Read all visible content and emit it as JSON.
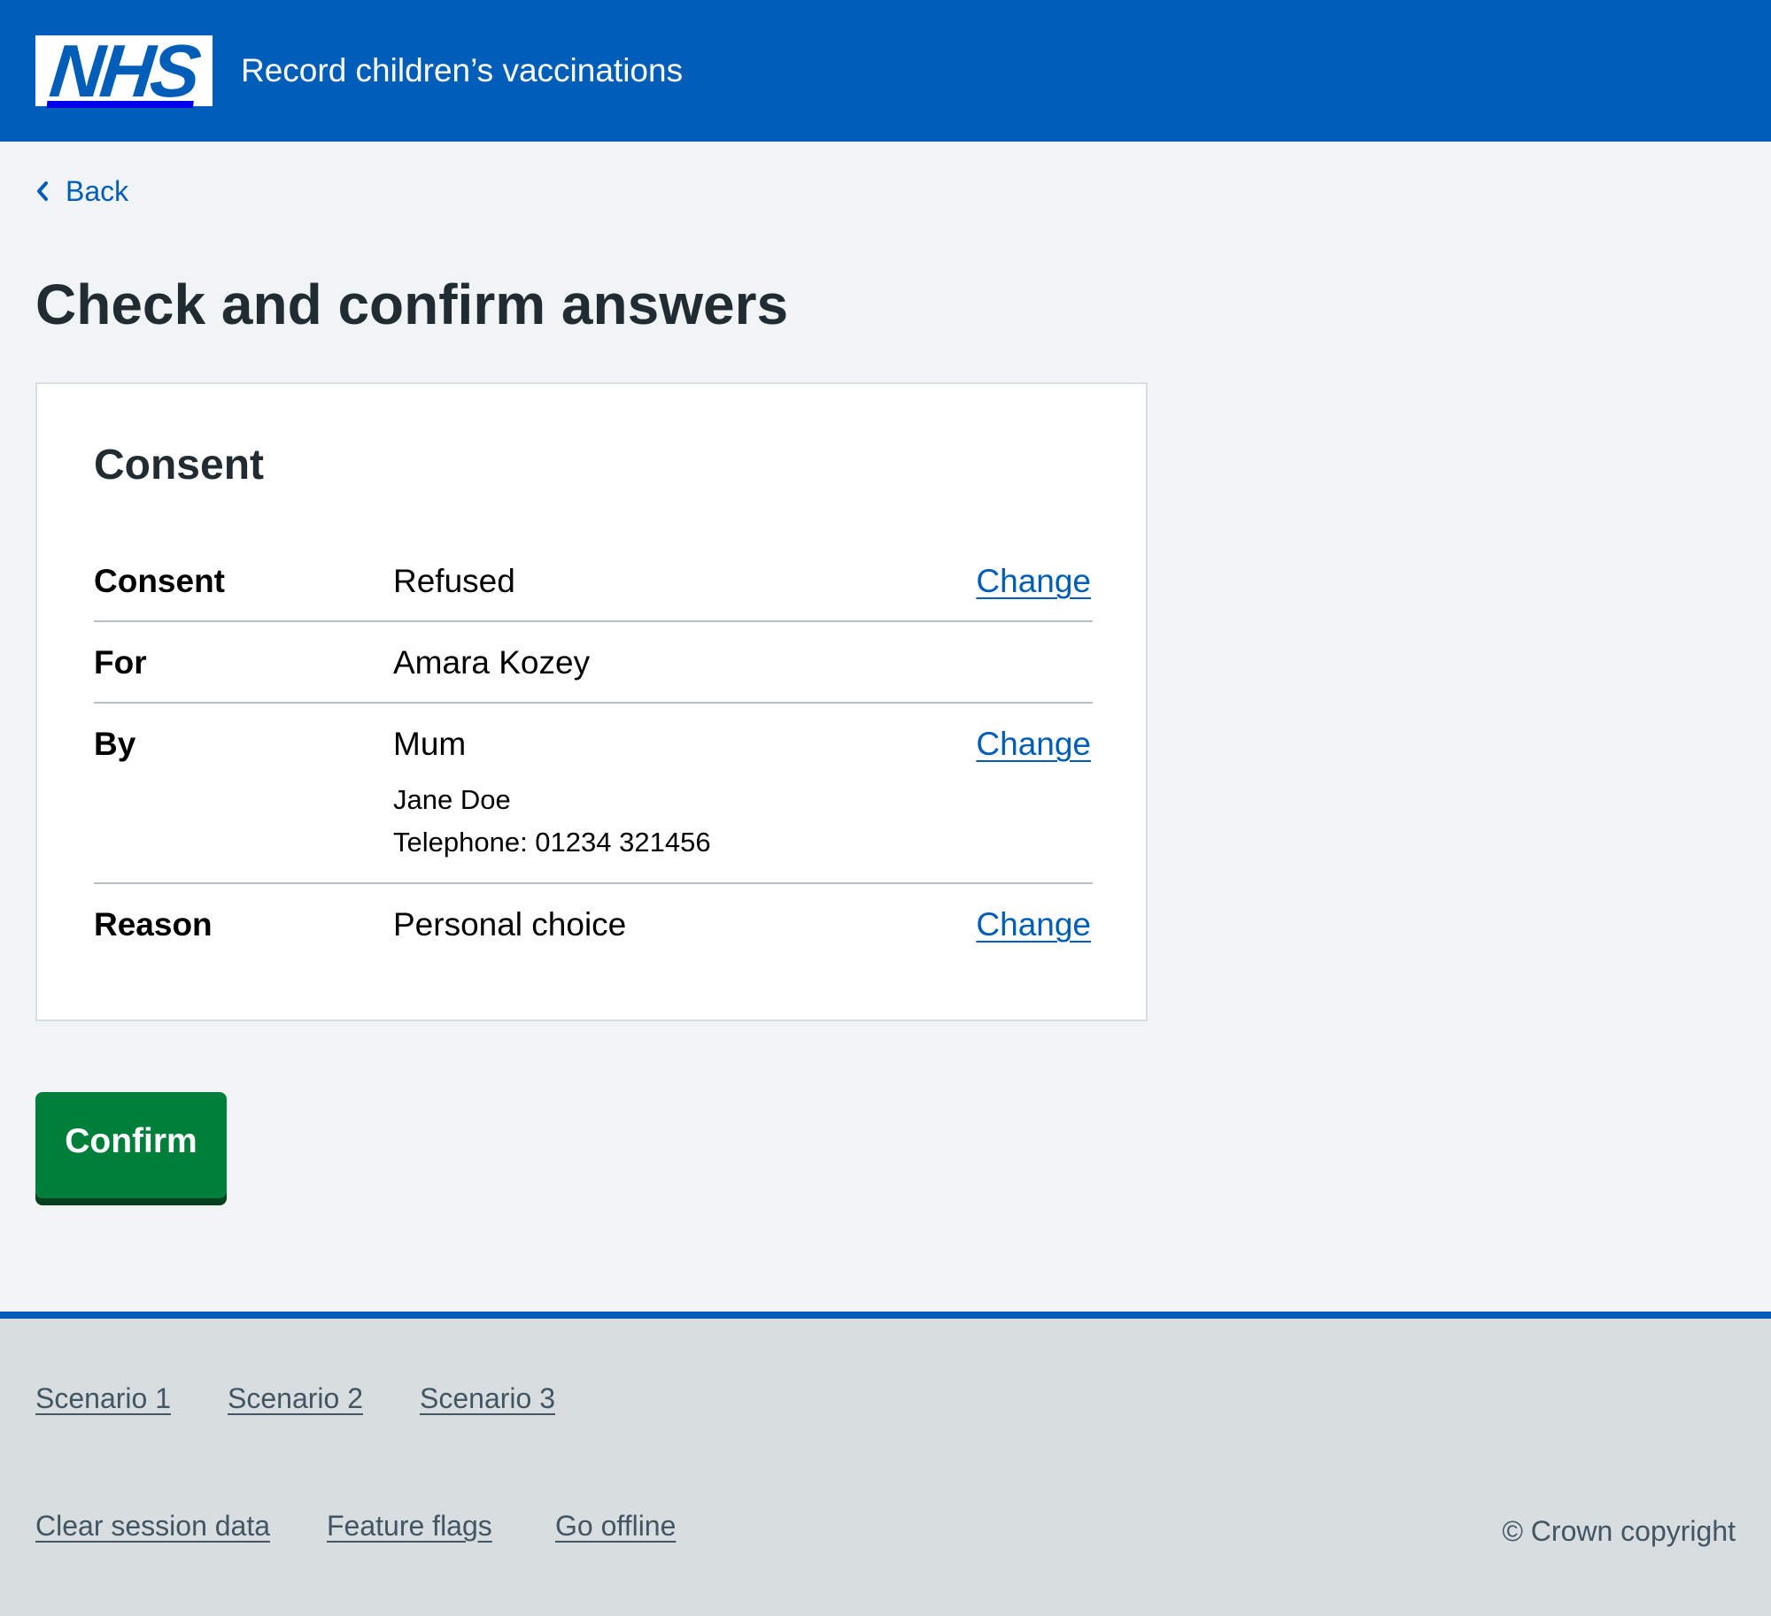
{
  "header": {
    "logo_text": "NHS",
    "service_name": "Record children’s vaccinations"
  },
  "back_link": {
    "label": "Back"
  },
  "page_title": "Check and confirm answers",
  "summary_card": {
    "title": "Consent",
    "rows": [
      {
        "key": "Consent",
        "value": "Refused",
        "action": "Change"
      },
      {
        "key": "For",
        "value": "Amara Kozey"
      },
      {
        "key": "By",
        "value": "Mum",
        "details": [
          "Jane Doe",
          "Telephone: 01234 321456"
        ],
        "action": "Change"
      },
      {
        "key": "Reason",
        "value": "Personal choice",
        "action": "Change"
      }
    ]
  },
  "confirm_button": {
    "label": "Confirm"
  },
  "footer": {
    "scenario_links": [
      "Scenario 1",
      "Scenario 2",
      "Scenario 3"
    ],
    "utility_links": [
      "Clear session data",
      "Feature flags",
      "Go offline"
    ],
    "copyright": "© Crown copyright"
  },
  "colors": {
    "brand_blue": "#005eb8",
    "page_background": "#f0f4f5",
    "text": "#212b32",
    "button_green": "#007f3b",
    "button_shadow": "#00401e",
    "footer_background": "#d8dde0",
    "footer_text": "#425563"
  },
  "icons": {
    "back": "chevron-left-icon"
  }
}
